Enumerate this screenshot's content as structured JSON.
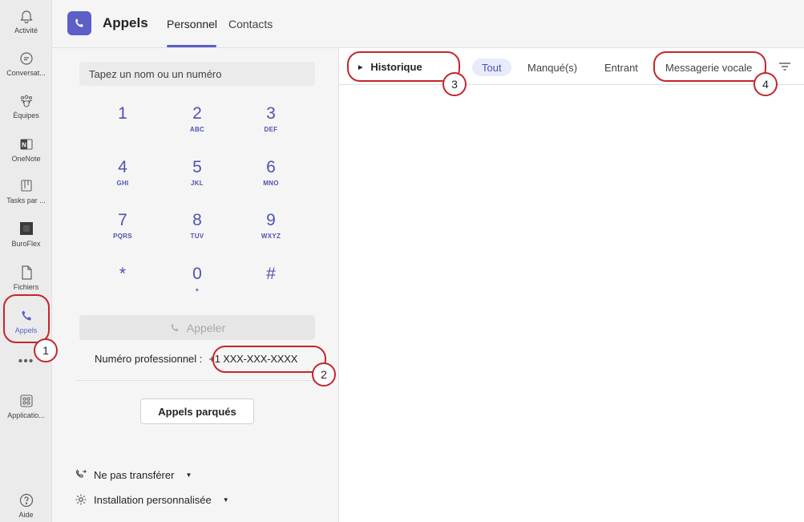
{
  "rail": {
    "items": [
      {
        "label": "Activité",
        "icon": "bell-icon"
      },
      {
        "label": "Conversat...",
        "icon": "chat-icon"
      },
      {
        "label": "Équipes",
        "icon": "teams-icon"
      },
      {
        "label": "OneNote",
        "icon": "onenote-icon"
      },
      {
        "label": "Tasks par ...",
        "icon": "tasks-icon"
      },
      {
        "label": "BuroFlex",
        "icon": "buroflex-icon"
      },
      {
        "label": "Fichiers",
        "icon": "file-icon"
      },
      {
        "label": "Appels",
        "icon": "phone-icon"
      },
      {
        "label": "Applicatio...",
        "icon": "apps-icon"
      },
      {
        "label": "Aide",
        "icon": "help-icon"
      }
    ],
    "more": "•••"
  },
  "header": {
    "title": "Appels",
    "tabs": [
      "Personnel",
      "Contacts"
    ]
  },
  "dialer": {
    "placeholder": "Tapez un nom ou un numéro",
    "keys": [
      {
        "digit": "1",
        "letters": ""
      },
      {
        "digit": "2",
        "letters": "ABC"
      },
      {
        "digit": "3",
        "letters": "DEF"
      },
      {
        "digit": "4",
        "letters": "GHI"
      },
      {
        "digit": "5",
        "letters": "JKL"
      },
      {
        "digit": "6",
        "letters": "MNO"
      },
      {
        "digit": "7",
        "letters": "PQRS"
      },
      {
        "digit": "8",
        "letters": "TUV"
      },
      {
        "digit": "9",
        "letters": "WXYZ"
      },
      {
        "digit": "*",
        "letters": ""
      },
      {
        "digit": "0",
        "letters": "+"
      },
      {
        "digit": "#",
        "letters": ""
      }
    ],
    "call_label": "Appeler",
    "work_number_label": "Numéro professionnel :",
    "work_number_value": "+1 XXX-XXX-XXXX",
    "parked_label": "Appels parqués",
    "forward_label": "Ne pas transférer",
    "setup_label": "Installation personnalisée"
  },
  "history": {
    "title": "Historique",
    "filters": [
      "Tout",
      "Manqué(s)",
      "Entrant",
      "Messagerie vocale"
    ]
  },
  "callouts": [
    "1",
    "2",
    "3",
    "4"
  ],
  "colors": {
    "accent": "#5b5fc7",
    "callout": "#c4262e"
  }
}
